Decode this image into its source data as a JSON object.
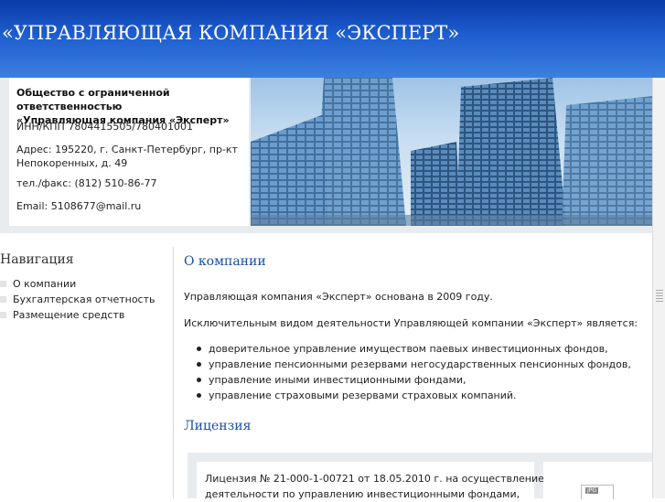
{
  "header": {
    "title": "«УПРАВЛЯЮЩАЯ КОМПАНИЯ «ЭКСПЕРТ»"
  },
  "info": {
    "org_line1": "Общество с ограниченной ответственностью",
    "org_line2": "«Управляющая компания «Эксперт»",
    "inn": "ИНН/КПП 7804415505/780401001",
    "addr_line1": "Адрес: 195220, г. Санкт-Петербург, пр-кт",
    "addr_line2": "Непокоренных, д. 49",
    "tel": "тел./факс: (812) 510-86-77",
    "email": "Email: 5108677@mail.ru"
  },
  "nav": {
    "title": "Навигация",
    "items": [
      "О компании",
      "Бухгалтерская отчетность",
      "Размещение средств"
    ]
  },
  "about": {
    "title": "О компании",
    "p1": "Управляющая компания «Эксперт» основана в 2009 году.",
    "p2": "Исключительным видом деятельности Управляющей компании «Эксперт» является:",
    "list": [
      "доверительное управление имуществом паевых инвестиционных фондов,",
      "управление пенсионными резервами негосударственных пенсионных фондов,",
      "управление иными инвестиционными фондами,",
      "управление страховыми резервами страховых компаний."
    ]
  },
  "license": {
    "title": "Лицензия",
    "line1": "Лицензия № 21-000-1-00721 от 18.05.2010 г. на осуществление",
    "line2": "деятельности по управлению инвестиционными фондами,",
    "file_badge": "JPG",
    "file_icon": "jpg-file-icon"
  }
}
